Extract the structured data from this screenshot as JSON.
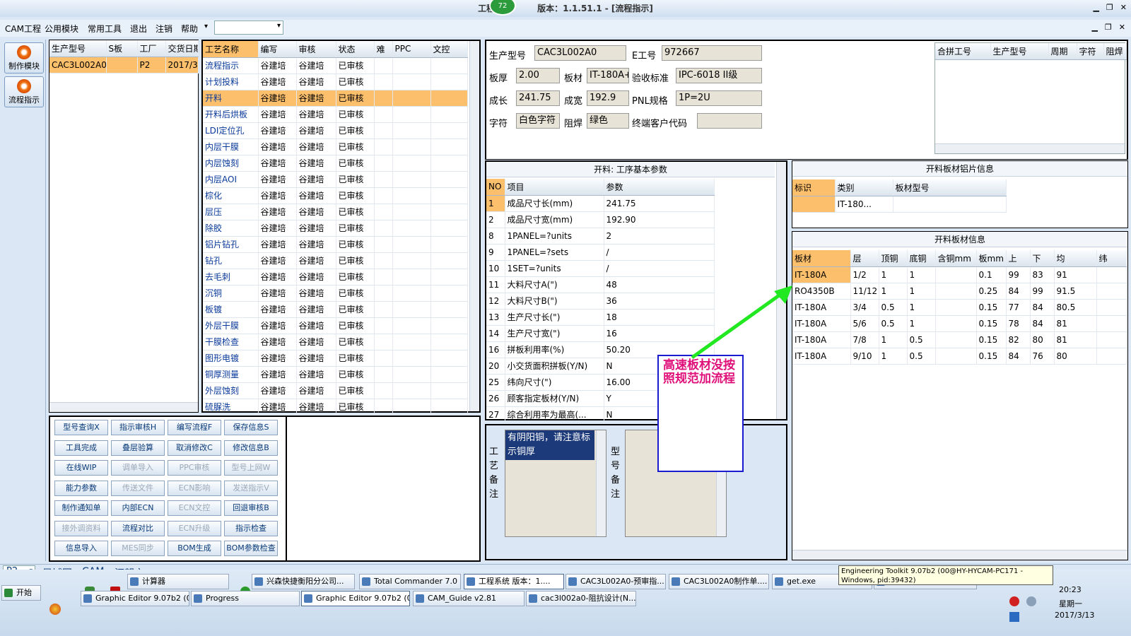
{
  "app": {
    "title_left": "工程",
    "title_right": "版本：1.1.51.1 - [流程指示]",
    "badge": "72",
    "win_min": "▁",
    "win_max": "❐",
    "win_close": "✕",
    "child_min": "▁",
    "child_max": "❐",
    "child_close": "✕"
  },
  "menu": {
    "items": [
      "CAM工程",
      "公用模块",
      "常用工具",
      "退出",
      "注销",
      "帮助"
    ],
    "arrow": "▾",
    "combo": "▾"
  },
  "side": {
    "btn1": "制作模块",
    "btn2": "流程指示"
  },
  "job": {
    "headers": [
      "生产型号",
      "S板",
      "工厂",
      "交货日期"
    ],
    "row": [
      "CAC3L002A0",
      "",
      "P2",
      "2017/3/"
    ]
  },
  "proc": {
    "headers": [
      "工艺名称",
      "编写",
      "审核",
      "状态",
      "难",
      "PPC",
      "文控"
    ],
    "rows": [
      [
        "流程指示",
        "谷建培",
        "谷建培",
        "已审核"
      ],
      [
        "计划投料",
        "谷建培",
        "谷建培",
        "已审核"
      ],
      [
        "开料",
        "谷建培",
        "谷建培",
        "已审核"
      ],
      [
        "开料后烘板",
        "谷建培",
        "谷建培",
        "已审核"
      ],
      [
        "LDI定位孔",
        "谷建培",
        "谷建培",
        "已审核"
      ],
      [
        "内层干膜",
        "谷建培",
        "谷建培",
        "已审核"
      ],
      [
        "内层蚀刻",
        "谷建培",
        "谷建培",
        "已审核"
      ],
      [
        "内层AOI",
        "谷建培",
        "谷建培",
        "已审核"
      ],
      [
        "棕化",
        "谷建培",
        "谷建培",
        "已审核"
      ],
      [
        "层压",
        "谷建培",
        "谷建培",
        "已审核"
      ],
      [
        "除胶",
        "谷建培",
        "谷建培",
        "已审核"
      ],
      [
        "铝片钻孔",
        "谷建培",
        "谷建培",
        "已审核"
      ],
      [
        "钻孔",
        "谷建培",
        "谷建培",
        "已审核"
      ],
      [
        "去毛刺",
        "谷建培",
        "谷建培",
        "已审核"
      ],
      [
        "沉铜",
        "谷建培",
        "谷建培",
        "已审核"
      ],
      [
        "板镀",
        "谷建培",
        "谷建培",
        "已审核"
      ],
      [
        "外层干膜",
        "谷建培",
        "谷建培",
        "已审核"
      ],
      [
        "干膜检查",
        "谷建培",
        "谷建培",
        "已审核"
      ],
      [
        "图形电镀",
        "谷建培",
        "谷建培",
        "已审核"
      ],
      [
        "铜厚测量",
        "谷建培",
        "谷建培",
        "已审核"
      ],
      [
        "外层蚀刻",
        "谷建培",
        "谷建培",
        "已审核"
      ],
      [
        "硫脲洗",
        "谷建培",
        "谷建培",
        "已审核"
      ]
    ]
  },
  "buttons": [
    [
      "型号查询X",
      "指示审核H",
      "编写流程F",
      "保存信息S"
    ],
    [
      "工具完成",
      "叠层验算",
      "取消修改C",
      "修改信息B"
    ],
    [
      "在线WIP",
      "调单导入",
      "PPC审核",
      "型号上网W"
    ],
    [
      "能力参数",
      "传送文件",
      "ECN影响",
      "发送指示V"
    ],
    [
      "制作通知单",
      "内部ECN",
      "ECN文控",
      "回退审核B"
    ],
    [
      "接外调资料",
      "流程对比",
      "ECN升级",
      "指示检查"
    ],
    [
      "信息导入",
      "MES同步",
      "BOM生成",
      "BOM参数检查"
    ]
  ],
  "buttons_disabled": [
    [
      false,
      false,
      false,
      false
    ],
    [
      false,
      false,
      false,
      false
    ],
    [
      false,
      true,
      true,
      true
    ],
    [
      false,
      true,
      true,
      true
    ],
    [
      false,
      false,
      true,
      false
    ],
    [
      true,
      false,
      true,
      false
    ],
    [
      false,
      true,
      false,
      false
    ]
  ],
  "info": {
    "l_model": "生产型号",
    "v_model": "CAC3L002A0",
    "l_eno": "E工号",
    "v_eno": "972667",
    "l_thick": "板厚",
    "v_thick": "2.00",
    "l_mat": "板材",
    "v_mat": "IT-180A+",
    "l_std": "验收标准",
    "v_std": "IPC-6018 II级",
    "l_len": "成长",
    "v_len": "241.75",
    "l_wid": "成宽",
    "v_wid": "192.9",
    "l_pnl": "PNL规格",
    "v_pnl": "1P=2U",
    "l_char": "字符",
    "v_char": "白色字符",
    "l_mask": "阻焊",
    "v_mask": "绿色",
    "l_cust": "终端客户代码",
    "v_cust": ""
  },
  "merge": {
    "headers": [
      "合拼工号",
      "生产型号",
      "周期",
      "字符",
      "阻焊"
    ]
  },
  "params": {
    "title": "开料: 工序基本参数",
    "headers": [
      "NO",
      "项目",
      "参数"
    ],
    "rows": [
      [
        "1",
        "成品尺寸长(mm)",
        "241.75"
      ],
      [
        "2",
        "成品尺寸宽(mm)",
        "192.90"
      ],
      [
        "8",
        "1PANEL=?units",
        "2"
      ],
      [
        "9",
        "1PANEL=?sets",
        "/"
      ],
      [
        "10",
        "1SET=?units",
        "/"
      ],
      [
        "11",
        "大料尺寸A(\")",
        "48"
      ],
      [
        "12",
        "大料尺寸B(\")",
        "36"
      ],
      [
        "13",
        "生产尺寸长(\")",
        "18"
      ],
      [
        "14",
        "生产尺寸宽(\")",
        "16"
      ],
      [
        "16",
        "拼板利用率(%)",
        "50.20"
      ],
      [
        "20",
        "小交货面积拼板(Y/N)",
        "N"
      ],
      [
        "25",
        "纬向尺寸(\")",
        "16.00"
      ],
      [
        "26",
        "顾客指定板材(Y/N)",
        "Y"
      ],
      [
        "27",
        "综合利用率为最高(...",
        "N"
      ]
    ]
  },
  "alu": {
    "title": "开料板材铝片信息",
    "headers": [
      "标识",
      "类别",
      "板材型号"
    ],
    "row": [
      "",
      "IT-180...",
      ""
    ]
  },
  "mat": {
    "title": "开料板材信息",
    "headers": [
      "板材",
      "层",
      "顶铜",
      "底铜",
      "含铜mm",
      "板mm",
      "上",
      "下",
      "均",
      "纬"
    ],
    "rows": [
      [
        "IT-180A",
        "1/2",
        "1",
        "1",
        "",
        "0.1",
        "99",
        "83",
        "91",
        ""
      ],
      [
        "RO4350B",
        "11/12",
        "1",
        "1",
        "",
        "0.25",
        "84",
        "99",
        "91.5",
        ""
      ],
      [
        "IT-180A",
        "3/4",
        "0.5",
        "1",
        "",
        "0.15",
        "77",
        "84",
        "80.5",
        ""
      ],
      [
        "IT-180A",
        "5/6",
        "0.5",
        "1",
        "",
        "0.15",
        "78",
        "84",
        "81",
        ""
      ],
      [
        "IT-180A",
        "7/8",
        "1",
        "0.5",
        "",
        "0.15",
        "82",
        "80",
        "81",
        ""
      ],
      [
        "IT-180A",
        "9/10",
        "1",
        "0.5",
        "",
        "0.15",
        "84",
        "76",
        "80",
        ""
      ]
    ]
  },
  "remarks": {
    "proc_label": "工艺备注",
    "proc_text": "有阴阳铜，请注意标示铜厚",
    "model_label": "型号备注"
  },
  "annotation": {
    "text": "高速板材没按照规范加流程"
  },
  "bottom_tabs": {
    "combo": "P2",
    "tabs": [
      "局域网",
      "CAM",
      "汪朝文"
    ]
  },
  "tooltip": "Engineering Toolkit 9.07b2 (00@HY-HYCAM-PC171 - Windows, pid:39432)",
  "taskbar": {
    "start": "开始",
    "row1": [
      "计算器",
      "兴森快捷衡阳分公司...",
      "Total Commander 7.0 ...",
      "工程系统  版本：1....",
      "CAC3L002A0-预审指...",
      "CAC3L002A0制作单....",
      "get.exe",
      "Engineering Toolkit 9...."
    ],
    "row2": [
      "Graphic Editor 9.07b2 (0...",
      "Progress",
      "Graphic Editor 9.07b2 (0...",
      "CAM_Guide v2.81",
      "cac3l002a0-阻抗设计(N..."
    ],
    "time": "20:23",
    "weekday": "星期一",
    "date": "2017/3/13"
  },
  "colors": {
    "selection": "#fcbf6c",
    "annotation_text": "#e0107a",
    "annotation_border": "#1a1ad0",
    "arrow": "#22e822"
  }
}
